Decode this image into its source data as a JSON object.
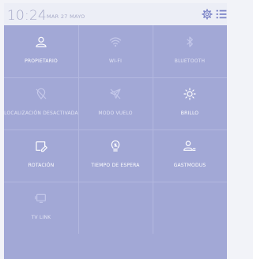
{
  "status_bar": {
    "time": "10:24",
    "date": "MAR 27 MAYO",
    "settings_icon": "gear-icon",
    "menu_icon": "list-menu-icon"
  },
  "colors": {
    "panel": "#a2a8d6",
    "status_bg": "#eceef6",
    "accent": "#7e86c8",
    "tile_divider": "#b3b8df"
  },
  "tiles": [
    {
      "label": "PROPIETARIO",
      "icon": "user-icon"
    },
    {
      "label": "WI-FI",
      "icon": "wifi-icon"
    },
    {
      "label": "BLUETOOTH",
      "icon": "bluetooth-icon"
    },
    {
      "label": "LOCALIZACIÓN DESACTIVADA",
      "icon": "location-off-icon"
    },
    {
      "label": "MODO VUELO",
      "icon": "airplane-icon"
    },
    {
      "label": "BRILLO",
      "icon": "brightness-icon"
    },
    {
      "label": "ROTACIÓN",
      "icon": "rotation-icon"
    },
    {
      "label": "TIEMPO DE ESPERA",
      "icon": "sleep-timer-icon"
    },
    {
      "label": "GASTMODUS",
      "icon": "guest-user-icon"
    },
    {
      "label": "TV LINK",
      "icon": "tv-link-icon"
    }
  ]
}
